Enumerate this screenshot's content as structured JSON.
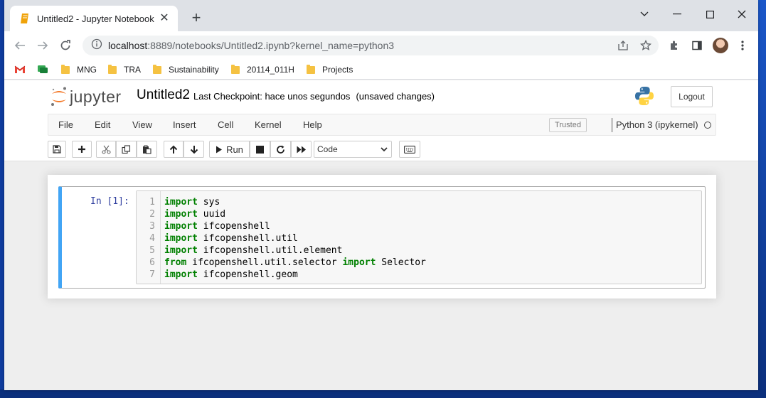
{
  "browser": {
    "tab": {
      "title": "Untitled2 - Jupyter Notebook"
    },
    "url": {
      "host": "localhost",
      "rest": ":8889/notebooks/Untitled2.ipynb?kernel_name=python3"
    },
    "bookmarks": [
      {
        "label": "MNG"
      },
      {
        "label": "TRA"
      },
      {
        "label": "Sustainability"
      },
      {
        "label": "20114_011H"
      },
      {
        "label": "Projects"
      }
    ]
  },
  "jupyter": {
    "logo_text": "jupyter",
    "notebook_name": "Untitled2",
    "checkpoint": "Last Checkpoint: hace unos segundos",
    "unsaved": "(unsaved changes)",
    "logout_label": "Logout",
    "menu": [
      "File",
      "Edit",
      "View",
      "Insert",
      "Cell",
      "Kernel",
      "Help"
    ],
    "trusted_label": "Trusted",
    "kernel_name": "Python 3 (ipykernel)",
    "run_label": "Run",
    "cell_type": "Code"
  },
  "cell": {
    "prompt": "In [1]:",
    "lines": [
      {
        "n": "1",
        "parts": [
          {
            "t": "import",
            "k": true
          },
          {
            "t": " sys"
          }
        ]
      },
      {
        "n": "2",
        "parts": [
          {
            "t": "import",
            "k": true
          },
          {
            "t": " uuid"
          }
        ]
      },
      {
        "n": "3",
        "parts": [
          {
            "t": "import",
            "k": true
          },
          {
            "t": " ifcopenshell"
          }
        ]
      },
      {
        "n": "4",
        "parts": [
          {
            "t": "import",
            "k": true
          },
          {
            "t": " ifcopenshell.util"
          }
        ]
      },
      {
        "n": "5",
        "parts": [
          {
            "t": "import",
            "k": true
          },
          {
            "t": " ifcopenshell.util.element"
          }
        ]
      },
      {
        "n": "6",
        "parts": [
          {
            "t": "from",
            "k": true
          },
          {
            "t": " ifcopenshell.util.selector "
          },
          {
            "t": "import",
            "k": true
          },
          {
            "t": " Selector"
          }
        ]
      },
      {
        "n": "7",
        "parts": [
          {
            "t": "import",
            "k": true
          },
          {
            "t": " ifcopenshell.geom"
          }
        ]
      }
    ]
  },
  "colors": {
    "keyword": "#008000",
    "prompt": "#303f9f",
    "selected_cell_bar": "#42a5f5",
    "tab_favicon": "#f0a30a"
  }
}
